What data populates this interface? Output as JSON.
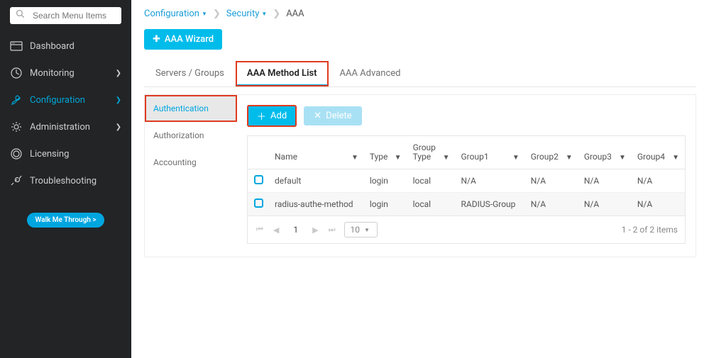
{
  "sidebar": {
    "search_placeholder": "Search Menu Items",
    "items": [
      {
        "label": "Dashboard",
        "icon": "dashboard",
        "active": false,
        "expandable": false
      },
      {
        "label": "Monitoring",
        "icon": "monitoring",
        "active": false,
        "expandable": true
      },
      {
        "label": "Configuration",
        "icon": "configuration",
        "active": true,
        "expandable": true
      },
      {
        "label": "Administration",
        "icon": "administration",
        "active": false,
        "expandable": true
      },
      {
        "label": "Licensing",
        "icon": "licensing",
        "active": false,
        "expandable": false
      },
      {
        "label": "Troubleshooting",
        "icon": "troubleshooting",
        "active": false,
        "expandable": false
      }
    ],
    "walk_label": "Walk Me Through >"
  },
  "breadcrumb": {
    "items": [
      {
        "label": "Configuration",
        "dropdown": true
      },
      {
        "label": "Security",
        "dropdown": true
      }
    ],
    "last": "AAA"
  },
  "wizard_button": "AAA Wizard",
  "tabs": {
    "items": [
      {
        "label": "Servers / Groups",
        "active": false,
        "highlight": false
      },
      {
        "label": "AAA Method List",
        "active": true,
        "highlight": true
      },
      {
        "label": "AAA Advanced",
        "active": false,
        "highlight": false
      }
    ]
  },
  "subtabs": {
    "items": [
      {
        "label": "Authentication",
        "active": true,
        "highlight": true
      },
      {
        "label": "Authorization",
        "active": false,
        "highlight": false
      },
      {
        "label": "Accounting",
        "active": false,
        "highlight": false
      }
    ]
  },
  "actions": {
    "add": "Add",
    "delete": "Delete"
  },
  "table": {
    "columns": [
      "Name",
      "Type",
      "Group Type",
      "Group1",
      "Group2",
      "Group3",
      "Group4"
    ],
    "rows": [
      {
        "name": "default",
        "type": "login",
        "group_type": "local",
        "g1": "N/A",
        "g2": "N/A",
        "g3": "N/A",
        "g4": "N/A"
      },
      {
        "name": "radius-authe-method",
        "type": "login",
        "group_type": "local",
        "g1": "RADIUS-Group",
        "g2": "N/A",
        "g3": "N/A",
        "g4": "N/A"
      }
    ]
  },
  "pager": {
    "page": "1",
    "page_size": "10",
    "summary": "1 - 2 of 2 items"
  }
}
